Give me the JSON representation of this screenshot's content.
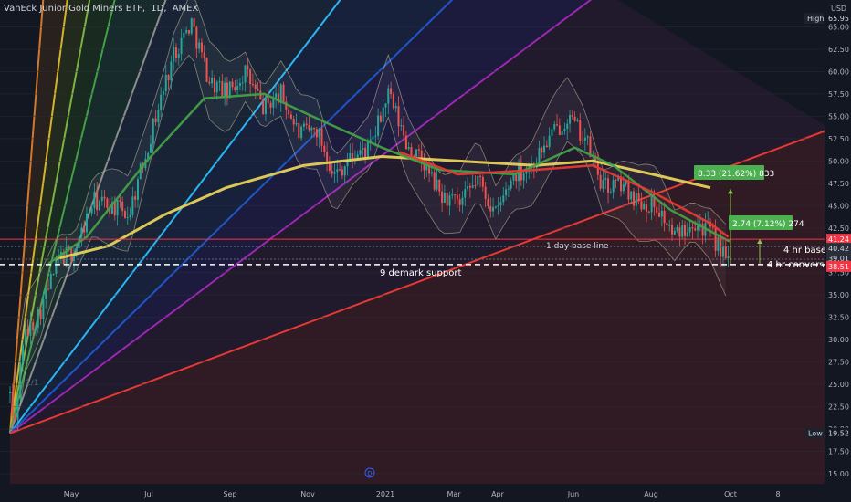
{
  "header": {
    "symbol": "VanEck Junior Gold Miners ETF",
    "interval": "1D",
    "exchange": "AMEX",
    "currency": "USD",
    "sep1": ",",
    "sep2": ","
  },
  "colors": {
    "background": "#131722",
    "up": "#26a69a",
    "down": "#ef5350",
    "ma_long": "#e6d15a",
    "ma_mid": "#43a047",
    "ma_fast": "#e53935",
    "fan_purple": "#9c27b0",
    "fan_blue": "#1e56c8",
    "fan_red": "#e53935",
    "label_green": "#4caf50",
    "label_red": "#f23645"
  },
  "price_badges": {
    "high": {
      "label": "High",
      "value": "65.95"
    },
    "low": {
      "label": "Low",
      "value": "19.52"
    },
    "last_red": "41.24",
    "marker_40": "40.42",
    "marker_39": "39.01",
    "close": "38.51"
  },
  "annotations": {
    "callout_upper": "8.33 (21.62%) 833",
    "callout_lower": "2.74 (7.12%) 274",
    "day_base": "1 day base line",
    "hr_base": "4 hr base",
    "hr_conversion": "4 hr conversion",
    "demark": "9 demark support",
    "fan_ratio": "1/1",
    "event_marker": "D"
  },
  "chart_data": {
    "type": "candlestick",
    "title": "VanEck Junior Gold Miners ETF, 1D, AMEX",
    "y_axis_ticks": [
      65.0,
      62.5,
      60.0,
      57.5,
      55.0,
      52.5,
      50.0,
      47.5,
      45.0,
      42.5,
      37.5,
      35.0,
      32.5,
      30.0,
      27.5,
      25.0,
      22.5,
      20.0,
      17.5,
      15.0
    ],
    "x_axis_ticks": [
      "May",
      "Jul",
      "Sep",
      "Nov",
      "2021",
      "Mar",
      "Apr",
      "Jun",
      "Aug",
      "Oct",
      "8"
    ],
    "ylim": [
      14.0,
      67.0
    ],
    "price_path": [
      [
        "2020-03-16",
        24.0
      ],
      [
        "2020-03-19",
        19.5
      ],
      [
        "2020-03-26",
        30.0
      ],
      [
        "2020-04-08",
        33.0
      ],
      [
        "2020-04-23",
        39.0
      ],
      [
        "2020-05-06",
        40.0
      ],
      [
        "2020-05-20",
        45.5
      ],
      [
        "2020-06-03",
        45.0
      ],
      [
        "2020-06-17",
        44.0
      ],
      [
        "2020-07-08",
        55.0
      ],
      [
        "2020-07-22",
        62.0
      ],
      [
        "2020-08-05",
        65.5
      ],
      [
        "2020-08-19",
        59.0
      ],
      [
        "2020-09-02",
        57.5
      ],
      [
        "2020-09-16",
        60.0
      ],
      [
        "2020-09-30",
        56.0
      ],
      [
        "2020-10-14",
        57.5
      ],
      [
        "2020-10-28",
        53.0
      ],
      [
        "2020-11-11",
        53.5
      ],
      [
        "2020-11-25",
        48.5
      ],
      [
        "2020-12-09",
        50.5
      ],
      [
        "2020-12-23",
        51.5
      ],
      [
        "2021-01-06",
        57.5
      ],
      [
        "2021-01-20",
        52.0
      ],
      [
        "2021-02-03",
        49.5
      ],
      [
        "2021-02-17",
        46.0
      ],
      [
        "2021-03-03",
        45.0
      ],
      [
        "2021-03-17",
        48.0
      ],
      [
        "2021-03-31",
        44.0
      ],
      [
        "2021-04-14",
        48.5
      ],
      [
        "2021-04-28",
        49.5
      ],
      [
        "2021-05-12",
        52.5
      ],
      [
        "2021-05-26",
        55.0
      ],
      [
        "2021-06-09",
        52.5
      ],
      [
        "2021-06-23",
        47.0
      ],
      [
        "2021-07-07",
        47.5
      ],
      [
        "2021-07-21",
        45.5
      ],
      [
        "2021-08-04",
        45.0
      ],
      [
        "2021-08-18",
        41.5
      ],
      [
        "2021-09-01",
        43.5
      ],
      [
        "2021-09-15",
        42.0
      ],
      [
        "2021-09-29",
        38.5
      ]
    ],
    "series": [
      {
        "name": "",
        "type": "moving-average",
        "points": [
          [
            "2020-04-20",
            39.0
          ],
          [
            "2020-06-01",
            40.5
          ],
          [
            "2020-07-15",
            44.0
          ],
          [
            "2020-09-01",
            47.0
          ],
          [
            "2020-11-01",
            49.5
          ],
          [
            "2021-01-01",
            50.5
          ],
          [
            "2021-03-01",
            50.0
          ],
          [
            "2021-05-01",
            49.5
          ],
          [
            "2021-06-15",
            50.0
          ],
          [
            "2021-08-01",
            48.5
          ],
          [
            "2021-09-15",
            47.0
          ]
        ]
      },
      {
        "name": "",
        "type": "moving-average",
        "points": [
          [
            "2020-04-15",
            38.5
          ],
          [
            "2020-05-15",
            41.5
          ],
          [
            "2020-07-01",
            50.0
          ],
          [
            "2020-08-15",
            57.0
          ],
          [
            "2020-10-01",
            57.5
          ],
          [
            "2020-11-15",
            54.5
          ],
          [
            "2021-01-01",
            51.5
          ],
          [
            "2021-02-15",
            49.0
          ],
          [
            "2021-04-15",
            48.5
          ],
          [
            "2021-06-01",
            51.5
          ],
          [
            "2021-07-01",
            49.5
          ],
          [
            "2021-08-15",
            44.5
          ],
          [
            "2021-09-30",
            41.0
          ]
        ]
      },
      {
        "name": "",
        "type": "moving-average",
        "points": [
          [
            "2021-01-15",
            51.0
          ],
          [
            "2021-03-01",
            48.5
          ],
          [
            "2021-05-01",
            49.0
          ],
          [
            "2021-06-15",
            49.5
          ],
          [
            "2021-08-01",
            46.5
          ],
          [
            "2021-09-15",
            43.0
          ],
          [
            "2021-09-29",
            41.5
          ]
        ]
      }
    ],
    "levels": [
      {
        "label": "1 day base line",
        "y": 41.24
      },
      {
        "label": "4 hr base",
        "y": 40.42
      },
      {
        "label": "4 hr conversion",
        "y": 39.01
      },
      {
        "label": "9 demark support",
        "y": 38.51
      }
    ],
    "measurements": [
      {
        "label": "8.33 (21.62%) 833",
        "from": 38.51,
        "to": 46.84
      },
      {
        "label": "2.74 (7.12%) 274",
        "from": 38.51,
        "to": 41.25
      }
    ],
    "high": 65.95,
    "low": 19.52
  }
}
